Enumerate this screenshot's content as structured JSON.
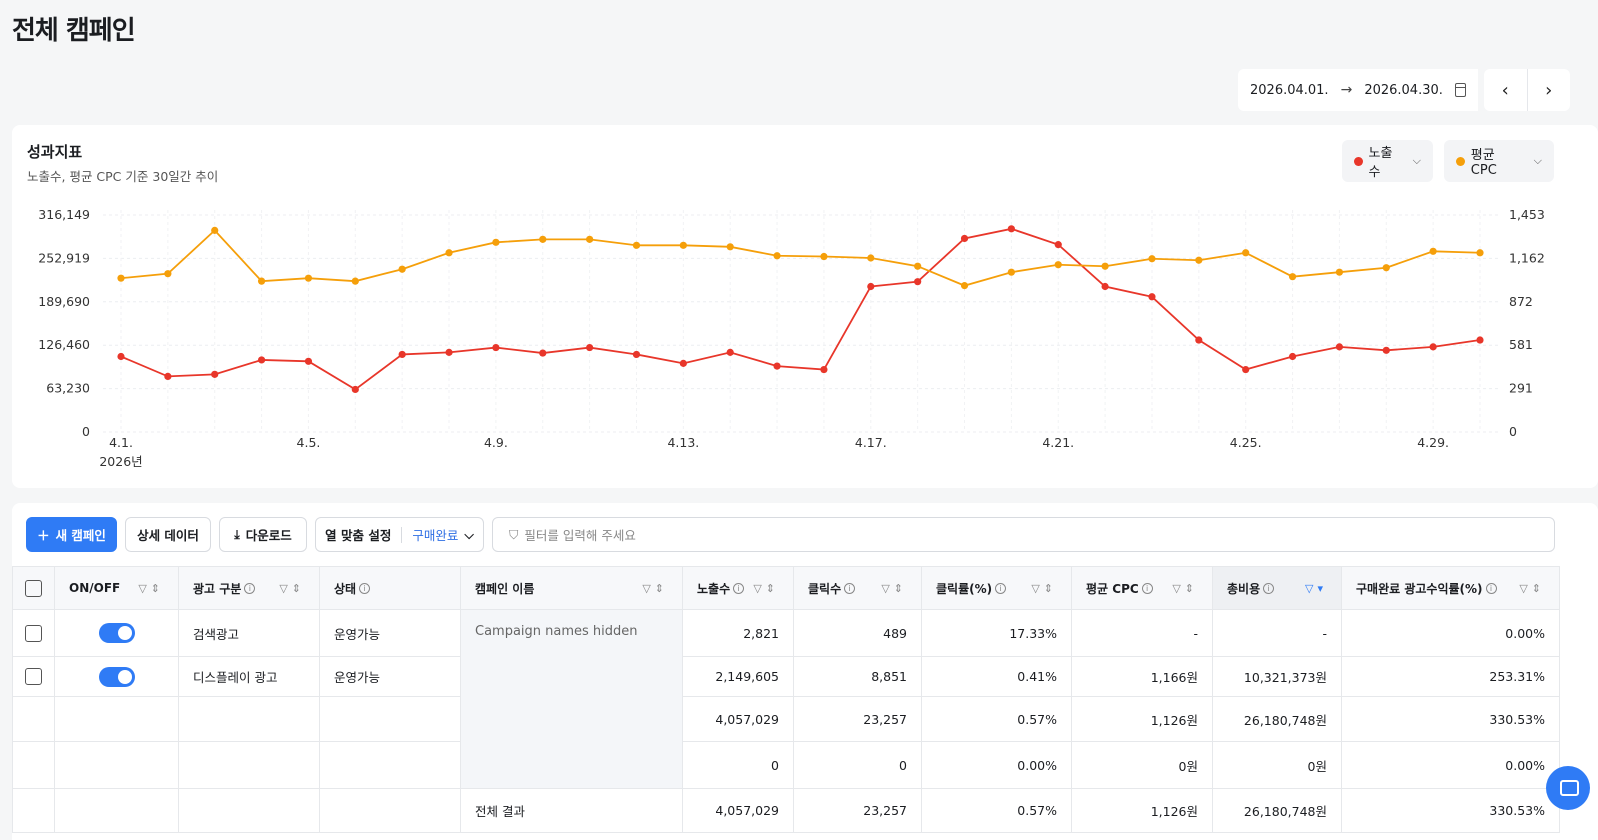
{
  "page": {
    "title": "전체 캠페인"
  },
  "date_range": {
    "start": "2026.04.01.",
    "end": "2026.04.30."
  },
  "chart_card": {
    "title": "성과지표",
    "subtitle": "노출수, 평균 CPC 기준 30일간 추이"
  },
  "legend": [
    {
      "label": "노출수",
      "color": "#e8362a"
    },
    {
      "label": "평균 CPC",
      "color": "#f59f0a"
    }
  ],
  "chart_data": {
    "type": "line",
    "x_tick_labels": [
      "4.1.",
      "4.5.",
      "4.9.",
      "4.13.",
      "4.17.",
      "4.21.",
      "4.25.",
      "4.29."
    ],
    "x_tick_index": [
      0,
      4,
      8,
      12,
      16,
      20,
      24,
      28
    ],
    "x_year_label": "2026년",
    "y_left_ticks": [
      "0",
      "63,230",
      "126,460",
      "189,690",
      "252,919",
      "316,149"
    ],
    "y_right_ticks": [
      "0",
      "291",
      "581",
      "872",
      "1,162",
      "1,453"
    ],
    "y_left_max": 316149,
    "y_right_max": 1453,
    "grid": true,
    "series": [
      {
        "name": "노출수",
        "color": "#e8362a",
        "axis": "left",
        "values": [
          110000,
          81000,
          84000,
          105000,
          103000,
          62000,
          113000,
          116000,
          123000,
          115000,
          123000,
          113000,
          100000,
          116000,
          96000,
          91000,
          212000,
          219000,
          282000,
          296000,
          273000,
          212000,
          197000,
          134000,
          91000,
          110000,
          124000,
          119000,
          124000,
          134000
        ]
      },
      {
        "name": "평균 CPC",
        "color": "#f59f0a",
        "axis": "right",
        "values": [
          1030,
          1060,
          1350,
          1010,
          1030,
          1010,
          1090,
          1200,
          1270,
          1290,
          1290,
          1250,
          1250,
          1240,
          1180,
          1175,
          1165,
          1110,
          980,
          1070,
          1120,
          1110,
          1160,
          1150,
          1200,
          1040,
          1070,
          1100,
          1210,
          1200
        ]
      }
    ]
  },
  "toolbar": {
    "new_campaign": "새 캠페인",
    "detail_data": "상세 데이터",
    "download": "다운로드",
    "column_setting": "열 맞춤 설정",
    "column_selected": "구매완료",
    "filter_placeholder": "필터를 입력해 주세요"
  },
  "table": {
    "headers": [
      "ON/OFF",
      "광고 구분",
      "상태",
      "캠페인 이름",
      "노출수",
      "클릭수",
      "클릭률(%)",
      "평균 CPC",
      "총비용",
      "구매완료 광고수익률(%)"
    ],
    "hidden_note": "Campaign names hidden",
    "rows": [
      {
        "type": "검색광고",
        "status": "운영가능",
        "impressions": "2,821",
        "clicks": "489",
        "ctr": "17.33%",
        "cpc": "-",
        "cost": "-",
        "roas": "0.00%"
      },
      {
        "type": "디스플레이 광고",
        "status": "운영가능",
        "impressions": "2,149,605",
        "clicks": "8,851",
        "ctr": "0.41%",
        "cpc": "1,166원",
        "cost": "10,321,373원",
        "roas": "253.31%"
      },
      {
        "impressions": "4,057,029",
        "clicks": "23,257",
        "ctr": "0.57%",
        "cpc": "1,126원",
        "cost": "26,180,748원",
        "roas": "330.53%"
      },
      {
        "impressions": "0",
        "clicks": "0",
        "ctr": "0.00%",
        "cpc": "0원",
        "cost": "0원",
        "roas": "0.00%"
      },
      {
        "name": "전체 결과",
        "impressions": "4,057,029",
        "clicks": "23,257",
        "ctr": "0.57%",
        "cpc": "1,126원",
        "cost": "26,180,748원",
        "roas": "330.53%"
      }
    ]
  }
}
